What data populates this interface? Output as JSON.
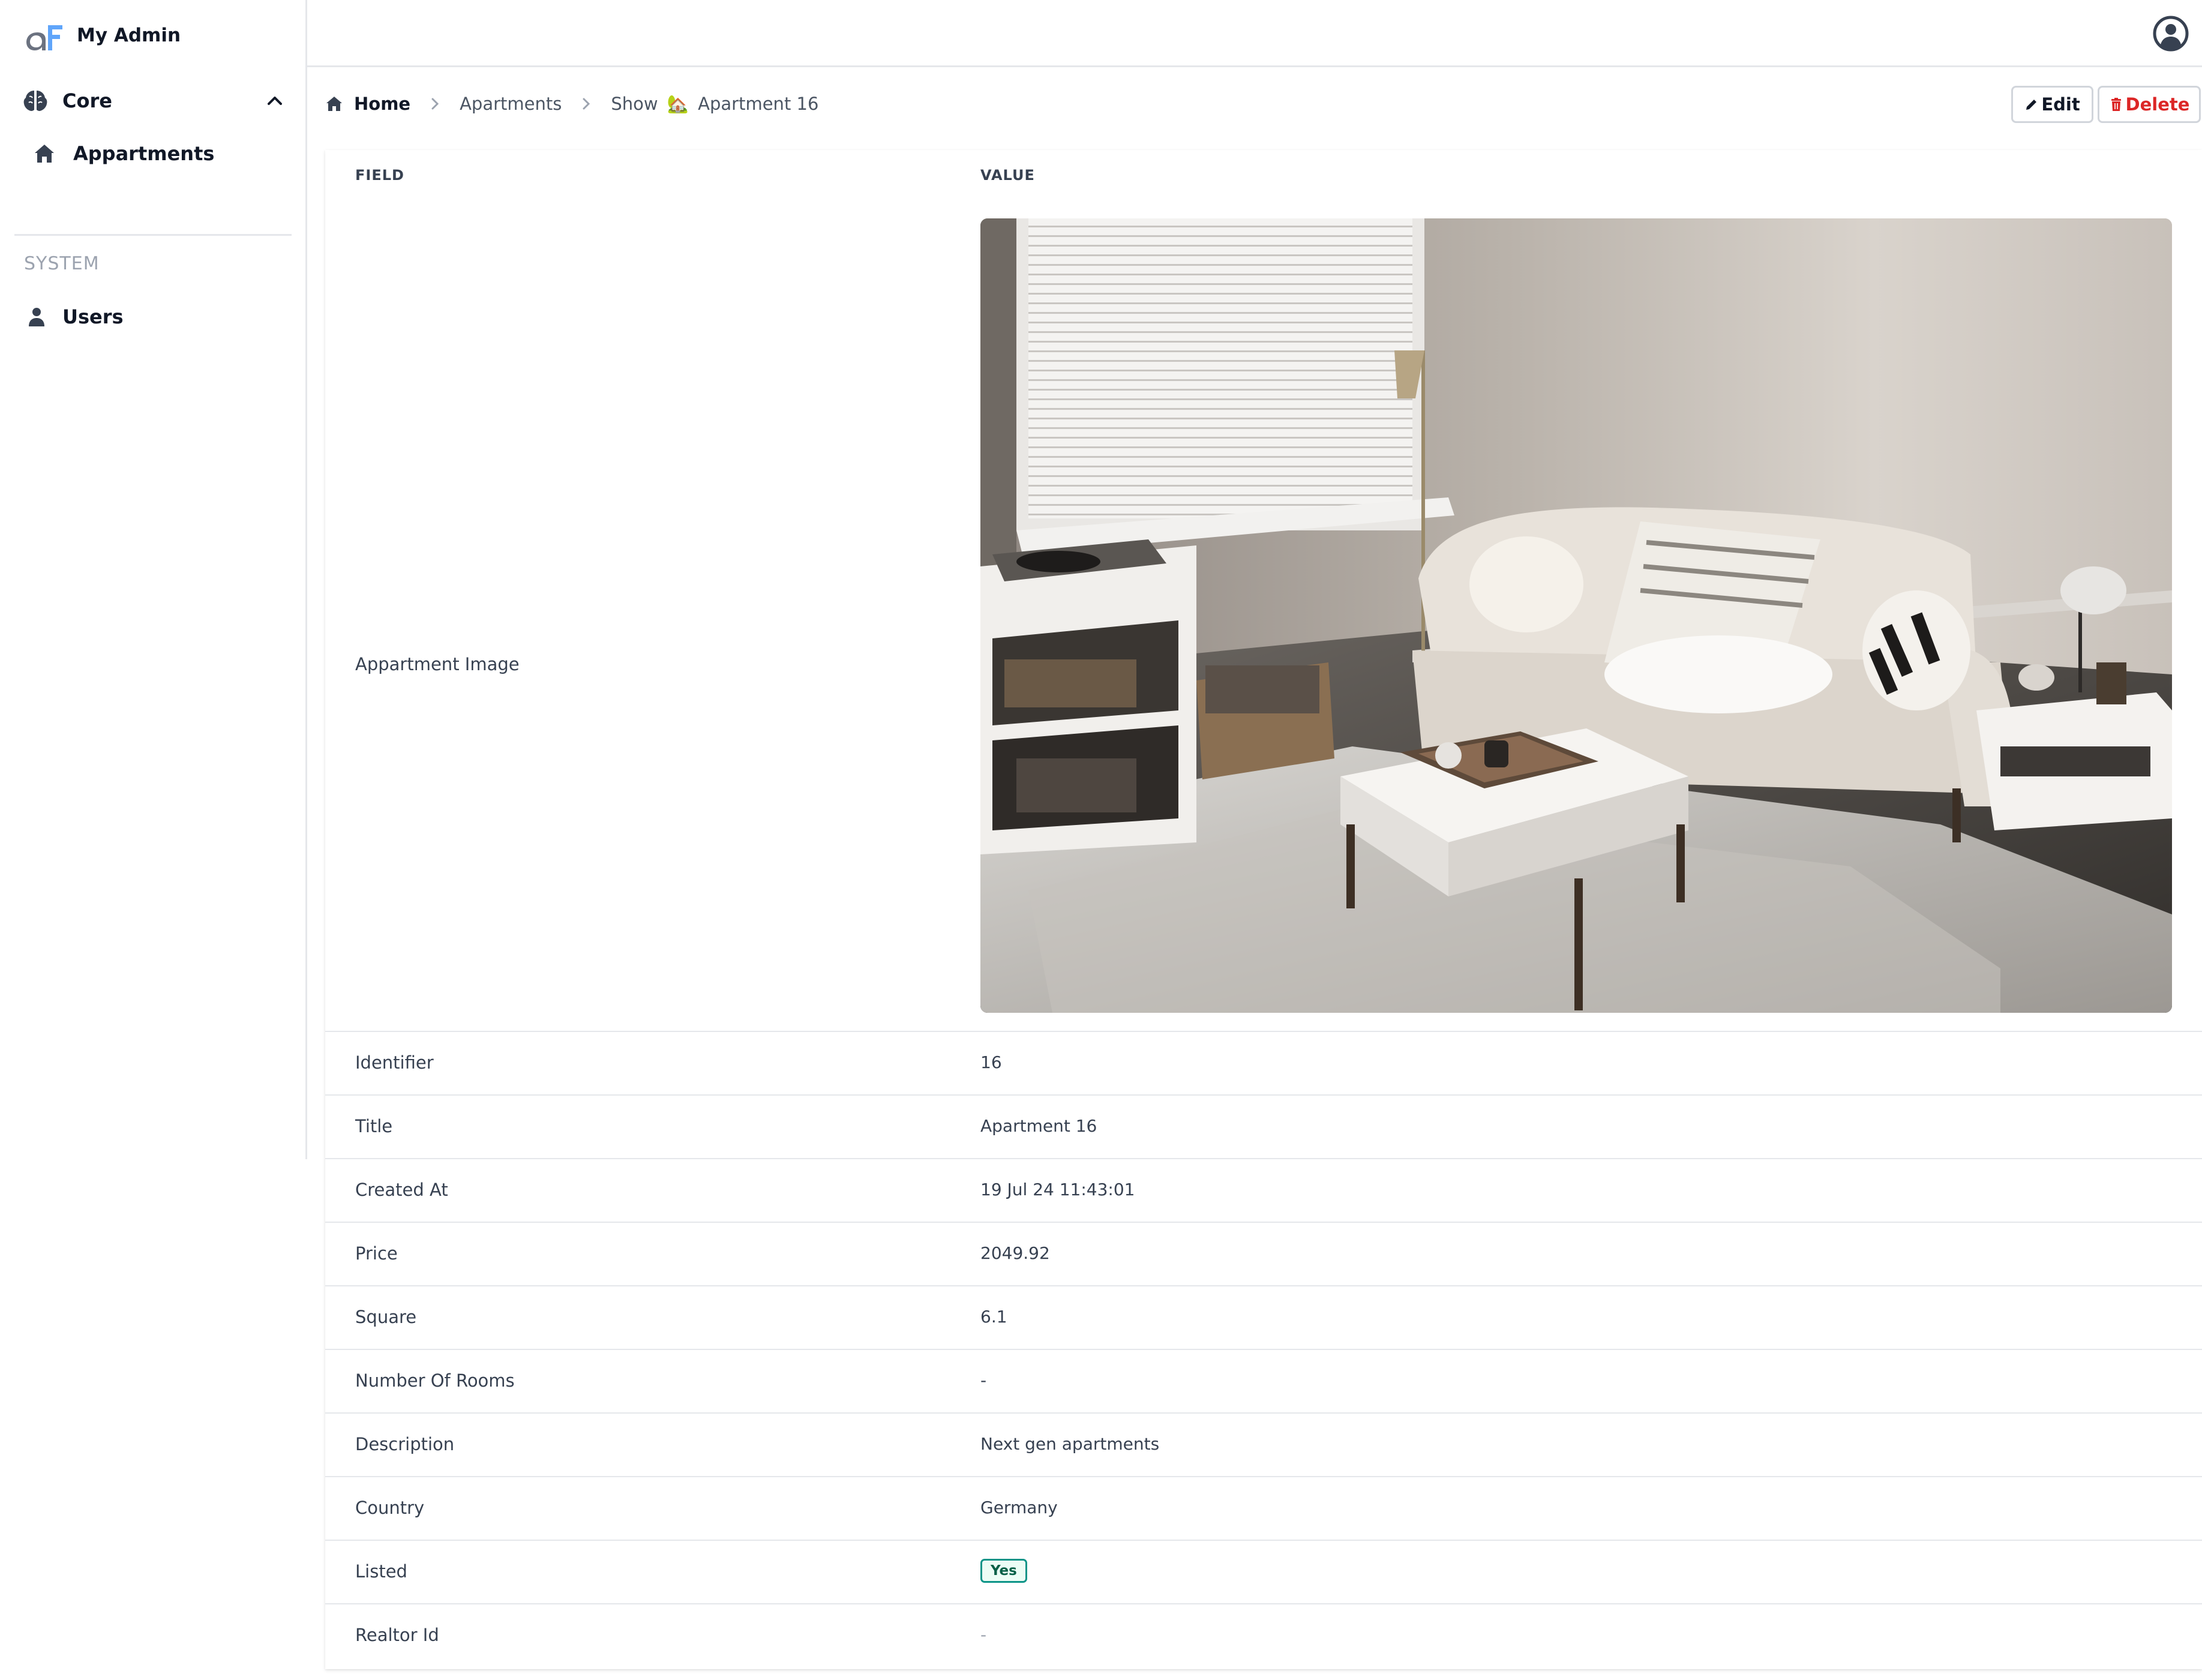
{
  "app": {
    "name": "My Admin"
  },
  "sidebar": {
    "groups": [
      {
        "label": "Core",
        "items": [
          {
            "label": "Appartments"
          }
        ]
      }
    ],
    "section_label": "SYSTEM",
    "system_items": [
      {
        "label": "Users"
      }
    ]
  },
  "breadcrumb": {
    "home": "Home",
    "resource": "Apartments",
    "action": "Show",
    "emoji": "🏡",
    "record": "Apartment 16"
  },
  "actions": {
    "edit": "Edit",
    "delete": "Delete"
  },
  "table": {
    "header_field": "FIELD",
    "header_value": "VALUE",
    "image_label": "Appartment Image",
    "rows": [
      {
        "label": "Identifier",
        "value": "16"
      },
      {
        "label": "Title",
        "value": "Apartment 16"
      },
      {
        "label": "Created At",
        "value": "19 Jul 24 11:43:01"
      },
      {
        "label": "Price",
        "value": "2049.92"
      },
      {
        "label": "Square",
        "value": "6.1"
      },
      {
        "label": "Number Of Rooms",
        "value": "-"
      },
      {
        "label": "Description",
        "value": "Next gen apartments"
      },
      {
        "label": "Country",
        "value": "Germany"
      },
      {
        "label": "Listed",
        "value": "Yes"
      },
      {
        "label": "Realtor Id",
        "value": "-"
      }
    ]
  },
  "icons": {
    "logo": "adminforth-logo-icon",
    "core": "brain-icon",
    "appartments": "home-icon",
    "users": "user-icon",
    "avatar": "user-circle-icon",
    "edit": "pencil-icon",
    "delete": "trash-icon"
  },
  "colors": {
    "brand_blue": "#3b82f6",
    "danger": "#dc2626",
    "badge_border": "#0d9488",
    "badge_bg": "#ecfdf5"
  }
}
